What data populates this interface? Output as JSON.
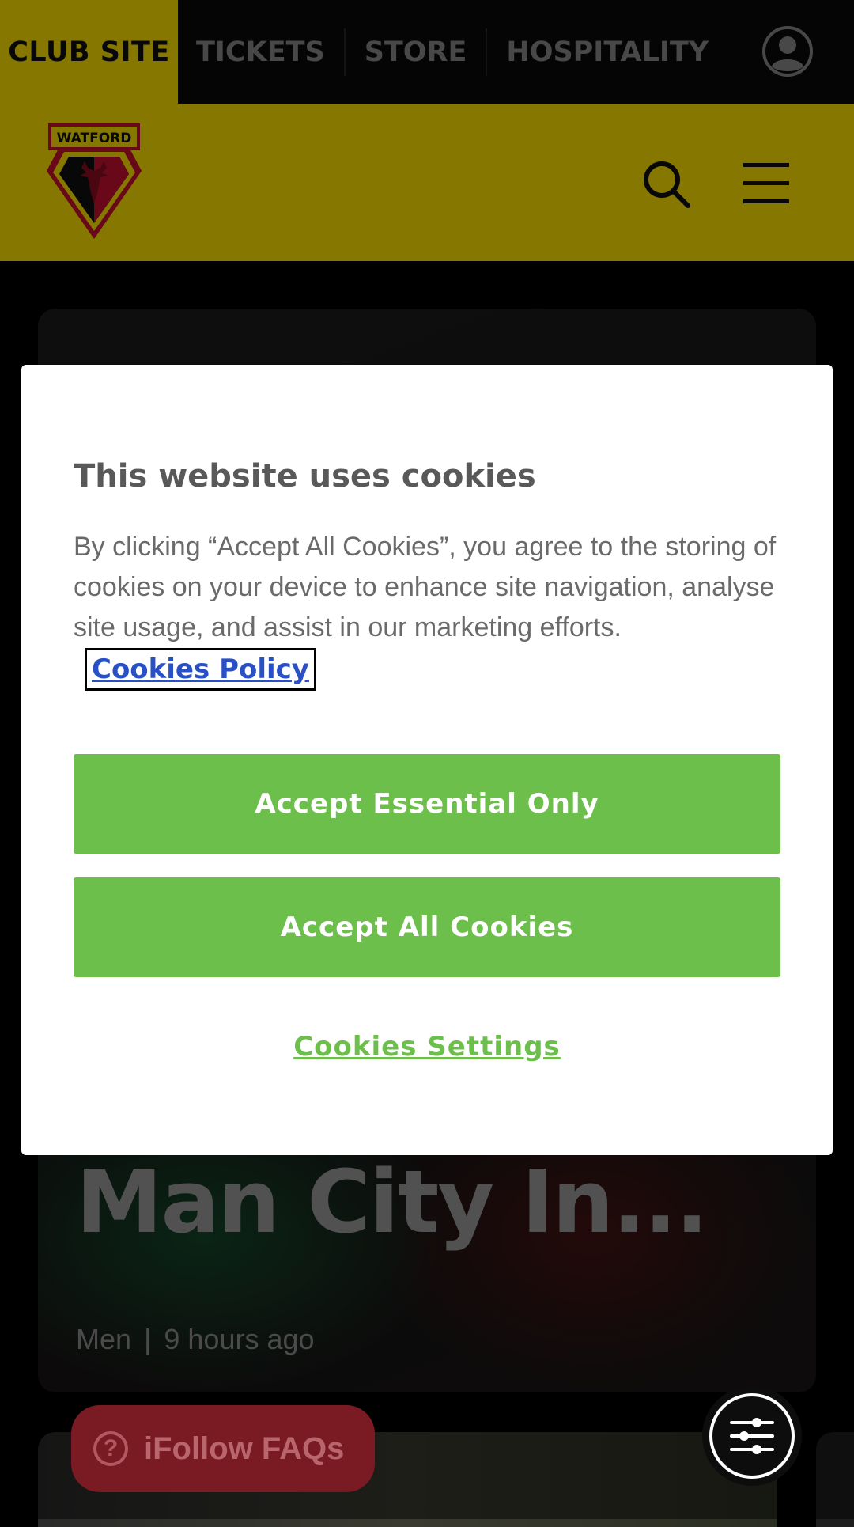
{
  "topnav": {
    "club_site": "CLUB SITE",
    "links": [
      "TICKETS",
      "STORE",
      "HOSPITALITY"
    ],
    "account_icon": "user-circle-icon"
  },
  "header": {
    "logo_text": "WATFORD",
    "search_icon": "search-icon",
    "menu_icon": "hamburger-menu-icon"
  },
  "article": {
    "headline": "Man City In...",
    "category": "Men",
    "separator": "|",
    "time": "9 hours ago"
  },
  "cookie_dialog": {
    "title": "This website uses cookies",
    "body": "By clicking “Accept All Cookies”, you agree to the storing of cookies on your device to enhance site navigation, analyse site usage, and assist in our marketing efforts.",
    "policy_link": "Cookies Policy",
    "accept_essential": "Accept Essential Only",
    "accept_all": "Accept All Cookies",
    "settings_link": "Cookies Settings"
  },
  "faq_button": {
    "icon": "question-circle-icon",
    "label": "iFollow FAQs"
  },
  "filter_button": {
    "icon": "sliders-icon"
  },
  "colors": {
    "brand_yellow": "#ffe500",
    "accept_green": "#6dbf4b",
    "link_blue": "#2a50c8",
    "faq_red": "#7a1a22"
  }
}
